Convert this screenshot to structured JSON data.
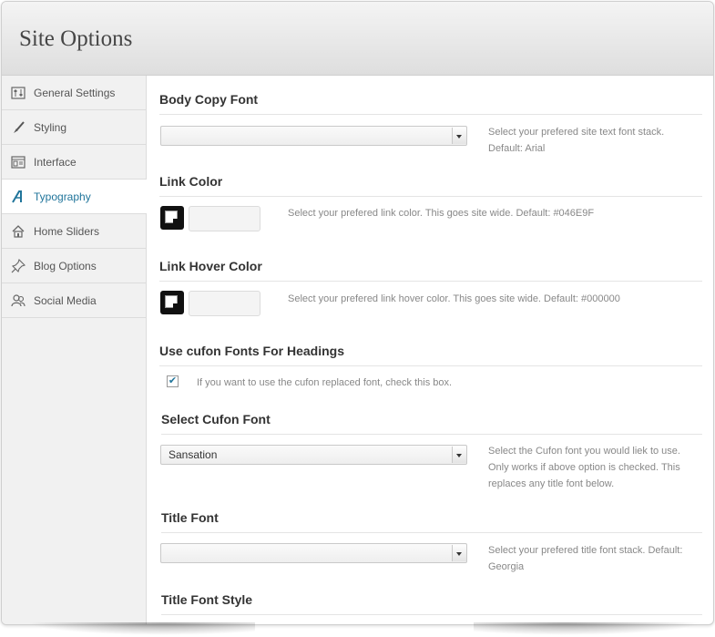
{
  "header": {
    "title": "Site Options"
  },
  "sidebar": {
    "items": [
      {
        "label": "General Settings",
        "icon": "settings-icon"
      },
      {
        "label": "Styling",
        "icon": "brush-icon"
      },
      {
        "label": "Interface",
        "icon": "layout-icon"
      },
      {
        "label": "Typography",
        "icon": "typography-icon",
        "active": true
      },
      {
        "label": "Home Sliders",
        "icon": "home-icon"
      },
      {
        "label": "Blog Options",
        "icon": "pin-icon"
      },
      {
        "label": "Social Media",
        "icon": "users-icon"
      }
    ]
  },
  "sections": {
    "body_font": {
      "title": "Body Copy Font",
      "value": "",
      "help": [
        "Select your prefered site text font stack.",
        "Default: Arial"
      ]
    },
    "link_color": {
      "title": "Link Color",
      "value": "",
      "help": "Select your prefered link color. This goes site wide. Default: #046E9F"
    },
    "link_hover_color": {
      "title": "Link Hover Color",
      "value": "",
      "help": "Select your prefered link hover color. This goes site wide. Default: #000000"
    },
    "cufon_headings": {
      "title": "Use cufon Fonts For Headings",
      "checked": true,
      "help": "If you want to use the cufon replaced font, check this box."
    },
    "cufon_font": {
      "title": "Select Cufon Font",
      "value": "Sansation",
      "help": [
        "Select the Cufon font you would liek to use.",
        "Only works if above option is checked. This",
        "replaces any title font below."
      ]
    },
    "title_font": {
      "title": "Title Font",
      "value": "",
      "help": [
        "Select your prefered title font stack. Default:",
        "Georgia"
      ]
    },
    "title_font_style": {
      "title": "Title Font Style"
    }
  },
  "colors": {
    "accent": "#21759b",
    "swatch": "#111111"
  }
}
